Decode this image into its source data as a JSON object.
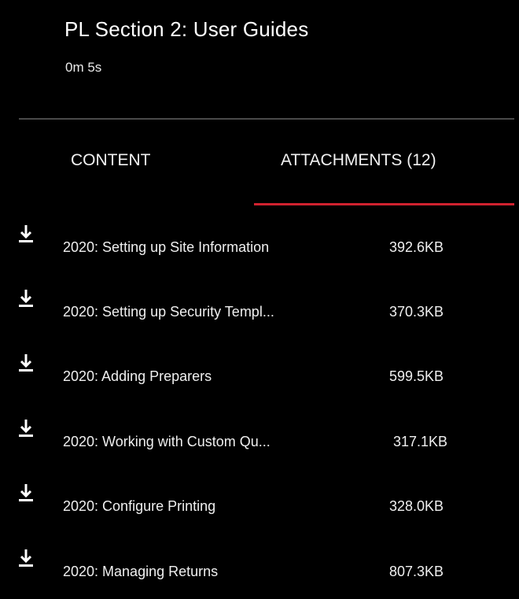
{
  "header": {
    "title": "PL Section 2: User Guides",
    "duration": "0m 5s"
  },
  "tabs": [
    {
      "label": "CONTENT",
      "active": false
    },
    {
      "label": "ATTACHMENTS (12)",
      "active": true
    }
  ],
  "colors": {
    "background": "#000000",
    "active_tab_underline": "#d0222f",
    "divider": "#4a4a4a"
  },
  "attachments": [
    {
      "name": "2020: Setting up Site Information",
      "size": "392.6KB",
      "icon": "download-icon"
    },
    {
      "name": "2020: Setting up Security Templ...",
      "size": "370.3KB",
      "icon": "download-icon"
    },
    {
      "name": "2020: Adding Preparers",
      "size": "599.5KB",
      "icon": "download-icon"
    },
    {
      "name": "2020: Working with Custom Qu...",
      "size": "317.1KB",
      "icon": "download-icon"
    },
    {
      "name": "2020: Configure Printing",
      "size": "328.0KB",
      "icon": "download-icon"
    },
    {
      "name": "2020: Managing Returns",
      "size": "807.3KB",
      "icon": "download-icon"
    }
  ]
}
